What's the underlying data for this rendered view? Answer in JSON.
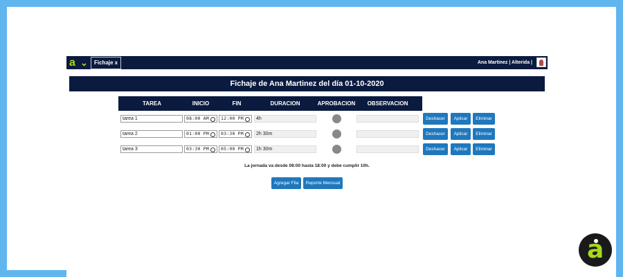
{
  "topbar": {
    "logo_letter": "a",
    "tab_label": "Fichaje",
    "tab_close": "x",
    "user_label": "Ana Martinez | Alterida |"
  },
  "title": "Fichaje de Ana Martinez del día 01-10-2020",
  "table": {
    "headers": [
      "TAREA",
      "INICIO",
      "FIN",
      "DURACION",
      "APROBACION",
      "OBSERVACION"
    ],
    "rows": [
      {
        "tarea": "tarea 1",
        "inicio": "08:00 AM",
        "fin": "12:00 PM",
        "duracion": "4h",
        "observacion": ""
      },
      {
        "tarea": "tarea 2",
        "inicio": "01:00 PM",
        "fin": "03:30 PM",
        "duracion": "2h 30m",
        "observacion": ""
      },
      {
        "tarea": "tarea 3",
        "inicio": "03:30 PM",
        "fin": "05:00 PM",
        "duracion": "1h 30m",
        "observacion": ""
      }
    ],
    "row_actions": [
      "Deshacer",
      "Aplicar",
      "Eliminar"
    ]
  },
  "note": "La jornada va desde 08:00 hasta 18:00 y debe cumplir 10h.",
  "buttons": {
    "add_row": "Agregar Fila",
    "monthly_report": "Reporte Mensual"
  },
  "colors": {
    "background": "#5fb5ee",
    "navy": "#0b1a3f",
    "button": "#1f78bd",
    "accent": "#a8d81c",
    "status": "#888888"
  },
  "corner_logo_letter": "a"
}
